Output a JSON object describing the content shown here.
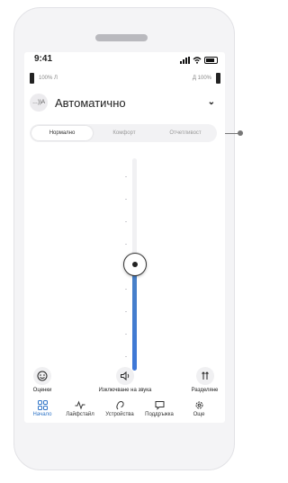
{
  "status": {
    "time": "9:41"
  },
  "devices": {
    "left_label": "100% Л",
    "right_label": "Д 100%"
  },
  "program": {
    "name": "Автоматично",
    "avatar_text": "…))A"
  },
  "modes": {
    "items": [
      "Нормално",
      "Комфорт",
      "Отчетливост"
    ],
    "selected": 0
  },
  "volume": {
    "value_fraction": 0.5
  },
  "quick_actions": {
    "ratings": "Оценки",
    "mute": "Изключване на звука",
    "split": "Разделяне"
  },
  "nav": {
    "items": [
      "Начало",
      "Лайфстайл",
      "Устройства",
      "Поддръжка",
      "Още"
    ],
    "selected": 0
  },
  "colors": {
    "accent": "#2f74c7",
    "fill": "#3d77d8"
  }
}
